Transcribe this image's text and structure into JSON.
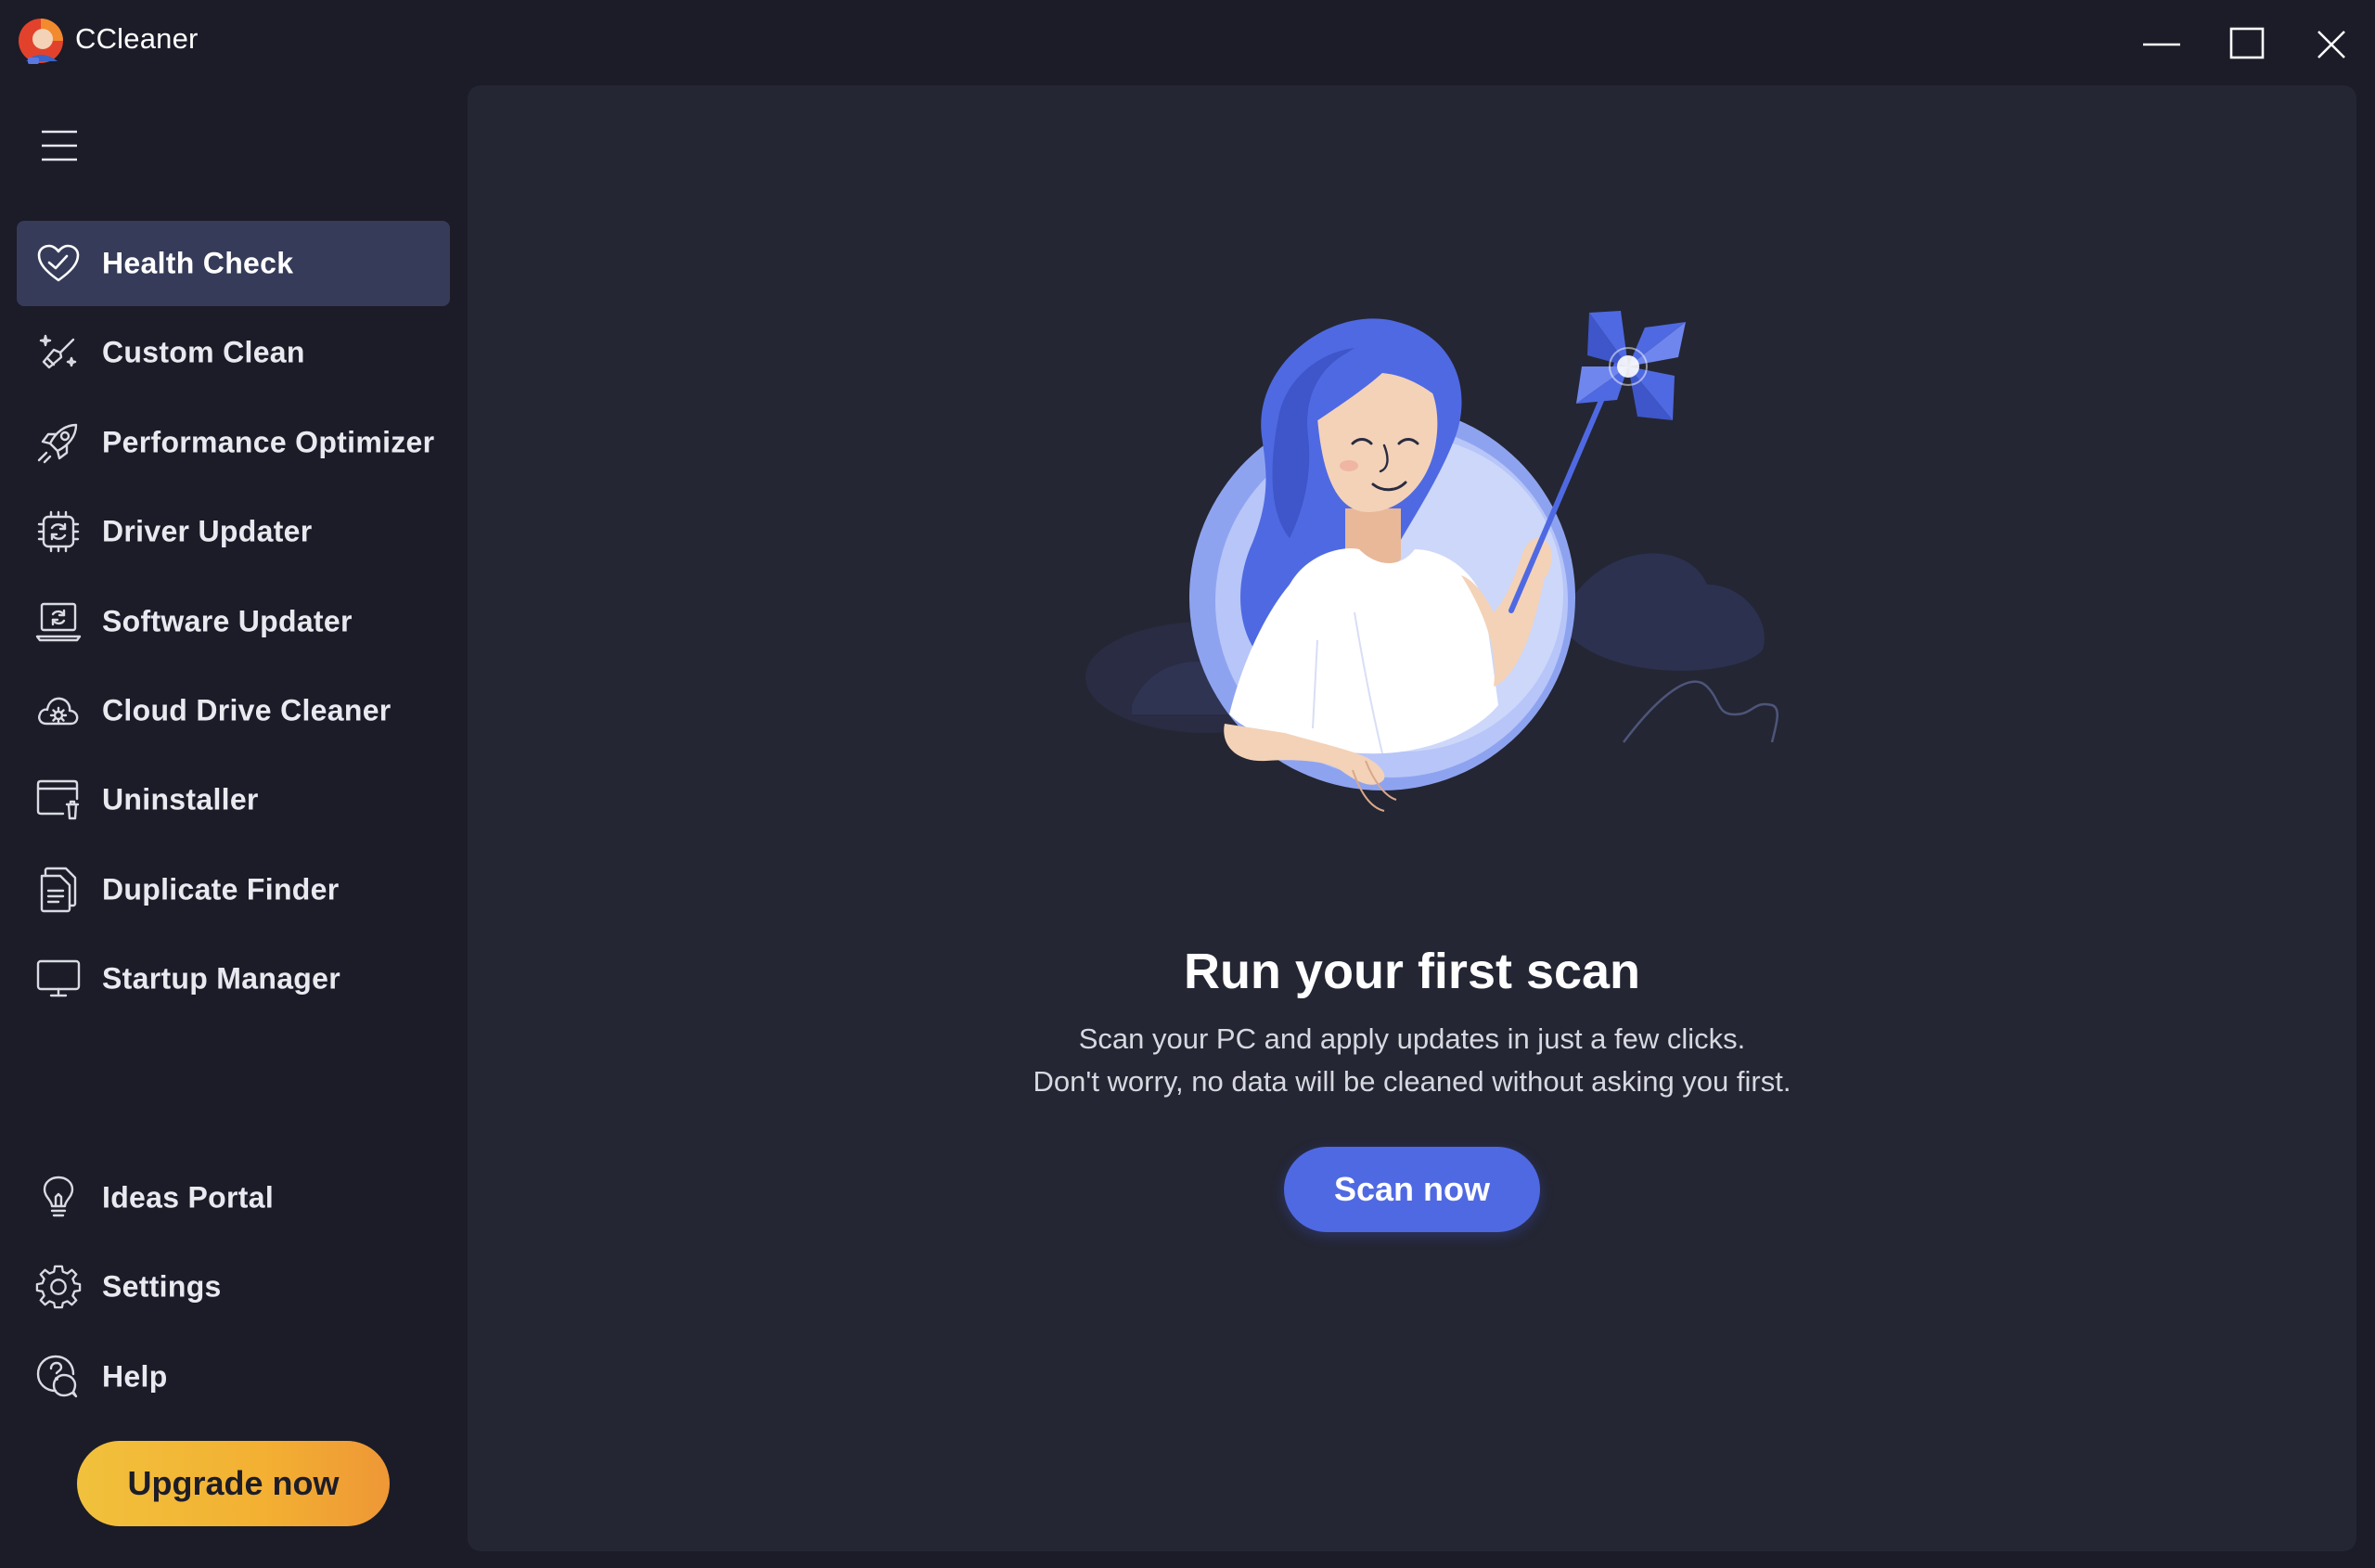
{
  "app": {
    "title": "CCleaner",
    "logo_icon": "ccleaner-logo-icon"
  },
  "window_controls": {
    "minimize_icon": "minimize-icon",
    "maximize_icon": "maximize-icon",
    "close_icon": "close-icon"
  },
  "sidebar": {
    "menu_icon": "hamburger-menu-icon",
    "items": [
      {
        "label": "Health Check",
        "icon": "heart-icon",
        "active": true
      },
      {
        "label": "Custom Clean",
        "icon": "broom-sparkle-icon",
        "active": false
      },
      {
        "label": "Performance Optimizer",
        "icon": "rocket-icon",
        "active": false
      },
      {
        "label": "Driver Updater",
        "icon": "chip-refresh-icon",
        "active": false
      },
      {
        "label": "Software Updater",
        "icon": "laptop-refresh-icon",
        "active": false
      },
      {
        "label": "Cloud Drive Cleaner",
        "icon": "cloud-gear-icon",
        "active": false
      },
      {
        "label": "Uninstaller",
        "icon": "window-trash-icon",
        "active": false
      },
      {
        "label": "Duplicate Finder",
        "icon": "duplicate-files-icon",
        "active": false
      },
      {
        "label": "Startup Manager",
        "icon": "monitor-icon",
        "active": false
      }
    ],
    "bottom_items": [
      {
        "label": "Ideas Portal",
        "icon": "lightbulb-icon"
      },
      {
        "label": "Settings",
        "icon": "gear-icon"
      },
      {
        "label": "Help",
        "icon": "help-chat-icon"
      }
    ],
    "upgrade_label": "Upgrade now"
  },
  "main": {
    "headline": "Run your first scan",
    "subline_1": "Scan your PC and apply updates in just a few clicks.",
    "subline_2": "Don't worry, no data will be cleaned without asking you first.",
    "scan_label": "Scan now",
    "illustration": "woman-with-pinwheel-illustration"
  },
  "colors": {
    "window_bg": "#1b1c28",
    "panel_bg": "#242633",
    "active_item_bg": "#353b58",
    "accent_blue": "#4f69e2",
    "upgrade_yellow": "#f1c13c",
    "upgrade_orange": "#ee9736"
  }
}
